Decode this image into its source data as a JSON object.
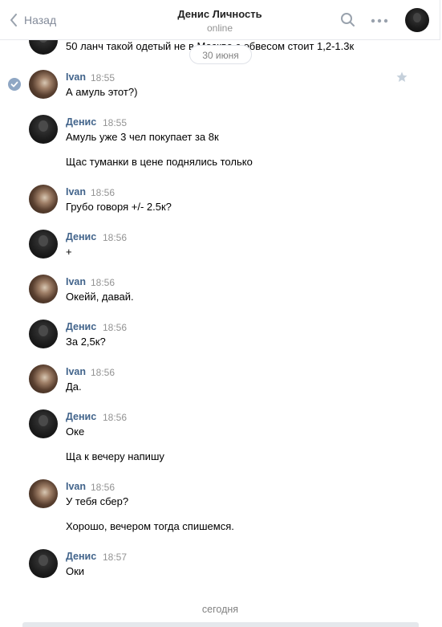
{
  "header": {
    "back_label": "Назад",
    "title": "Денис Личность",
    "status": "online"
  },
  "date_separator": "30 июня",
  "top_partial_text": "50 ланч такой одетый не в Москве с обвесом стоит 1,2-1.3к",
  "messages": [
    {
      "author": "Ivan",
      "time": "18:55",
      "lines": [
        "А амуль этот?)"
      ]
    },
    {
      "author": "Денис",
      "time": "18:55",
      "lines": [
        "Амуль уже 3 чел покупает за 8к",
        "Щас туманки в цене поднялись только"
      ]
    },
    {
      "author": "Ivan",
      "time": "18:56",
      "lines": [
        "Грубо говоря +/- 2.5к?"
      ]
    },
    {
      "author": "Денис",
      "time": "18:56",
      "lines": [
        "+"
      ]
    },
    {
      "author": "Ivan",
      "time": "18:56",
      "lines": [
        "Окейй, давай."
      ]
    },
    {
      "author": "Денис",
      "time": "18:56",
      "lines": [
        "За 2,5к?"
      ]
    },
    {
      "author": "Ivan",
      "time": "18:56",
      "lines": [
        "Да."
      ]
    },
    {
      "author": "Денис",
      "time": "18:56",
      "lines": [
        "Оке",
        "Ща к вечеру напишу"
      ]
    },
    {
      "author": "Ivan",
      "time": "18:56",
      "lines": [
        "У тебя сбер?",
        "Хорошо, вечером тогда спишемся."
      ]
    },
    {
      "author": "Денис",
      "time": "18:57",
      "lines": [
        "Оки"
      ]
    }
  ],
  "today_label": "сегодня",
  "colors": {
    "author": "#42648b",
    "meta": "#939393",
    "divider": "#e7e8ec"
  }
}
